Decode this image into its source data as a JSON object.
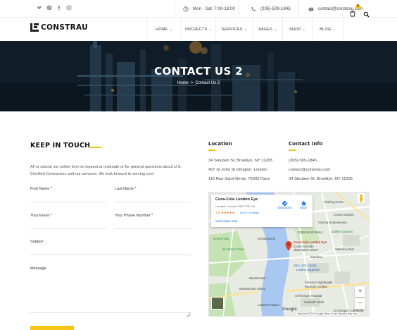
{
  "topbar": {
    "social": [
      {
        "name": "twitter-icon",
        "glyph": "t"
      },
      {
        "name": "pinterest-icon",
        "glyph": "p"
      },
      {
        "name": "facebook-icon",
        "glyph": "f"
      },
      {
        "name": "instagram-icon",
        "glyph": "◎"
      }
    ],
    "hours": "Mon - Sat: 7:00-18:00",
    "phone": "(205)-509-1845",
    "email": "contact@constrau.com"
  },
  "header": {
    "logo": "CONSTRAU",
    "nav": [
      {
        "label": "HOME"
      },
      {
        "label": "PROJECTS"
      },
      {
        "label": "SERVICES"
      },
      {
        "label": "PAGES"
      },
      {
        "label": "SHOP"
      },
      {
        "label": "BLOG"
      }
    ],
    "cart_count": "0"
  },
  "hero": {
    "title": "CONTACT US 2",
    "breadcrumb_home": "Home",
    "breadcrumb_sep": ">",
    "breadcrumb_current": "Contact Us 2"
  },
  "form": {
    "title": "KEEP IN TOUCH",
    "intro": "All or submit our online form to request an estimate or for general questions about U.S. Certified Contractors and our services. We look forward to serving you!",
    "first_name": "First Name *",
    "last_name": "Last Name *",
    "email": "Your Email *",
    "phone": "Your Phone Number *",
    "subject": "Subject",
    "message": "Message"
  },
  "location": {
    "title": "Location",
    "lines": [
      "34 Steuben St, Brooklyn, NY 11205",
      "407 St John St Islington, London",
      "116 Rue Saint-Denis, 75002 Paris"
    ]
  },
  "contact_info": {
    "title": "Contact info",
    "lines": [
      "(205)-509-1845",
      "contact@constrau.com",
      "34 Steuben St, Brooklyn, NY 11205"
    ]
  },
  "map": {
    "card_title": "Coca-Cola London Eye",
    "card_subtitle": "Lambeth, London SE1 7PB, UK",
    "rating": "4.5 ★★★★★",
    "reviews": "87,977 reviews",
    "larger_map": "View larger map",
    "directions": "Directions",
    "save": "Save",
    "labels": [
      {
        "text": "Jubilee Gardens",
        "style": "green"
      },
      {
        "text": "ODEON BFI IMAX",
        "style": ""
      },
      {
        "text": "Waterloo East",
        "style": ""
      },
      {
        "text": "Waterloo",
        "style": ""
      },
      {
        "text": "Coca-Cola London Eye",
        "style": "red"
      },
      {
        "text": "Iconic riverside",
        "style": ""
      },
      {
        "text": "observation wheel",
        "style": ""
      },
      {
        "text": "SEA LIFE Centre",
        "style": "blue"
      },
      {
        "text": "London Aquarium",
        "style": "blue"
      },
      {
        "text": "Florence Nightingale",
        "style": ""
      },
      {
        "text": "Museum London",
        "style": ""
      },
      {
        "text": "Westminster Abbey",
        "style": ""
      },
      {
        "text": "St Thomas' Hospital",
        "style": ""
      },
      {
        "text": "Lambeth North",
        "style": ""
      },
      {
        "text": "St James's Park",
        "style": "green"
      },
      {
        "text": "Westminster",
        "style": ""
      },
      {
        "text": "Covent Garden",
        "style": ""
      },
      {
        "text": "Lambeth Palace",
        "style": ""
      },
      {
        "text": "Green Park",
        "style": "green"
      },
      {
        "text": "Embankment",
        "style": ""
      },
      {
        "text": "Charing Cross",
        "style": ""
      },
      {
        "text": "Victoria Embankment",
        "style": ""
      },
      {
        "text": "St George's Cathedral",
        "style": ""
      }
    ],
    "google": "Google",
    "footer": "Map data ©2018 Google   Terms of Use   Report a map error"
  },
  "colors": {
    "accent": "#f5c518",
    "text_dark": "#111111",
    "muted": "#555555",
    "map_water": "#a9c8f1",
    "map_land": "#dfe6d9"
  }
}
